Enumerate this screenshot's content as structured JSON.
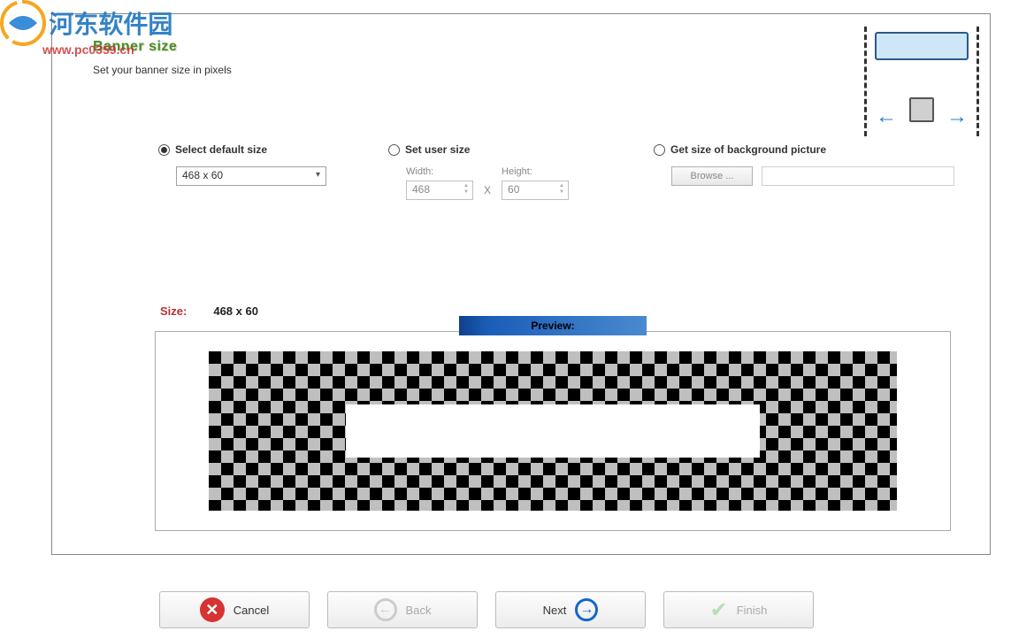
{
  "watermark": {
    "text": "河东软件园",
    "url": "www.pc0359.cn"
  },
  "header": {
    "title": "Banner size",
    "subtitle": "Set your banner size in pixels"
  },
  "options": {
    "selected": "default",
    "default": {
      "label": "Select default size",
      "value": "468 x 60"
    },
    "user": {
      "label": "Set user size",
      "width_label": "Width:",
      "width_value": "468",
      "sep": "X",
      "height_label": "Height:",
      "height_value": "60"
    },
    "background": {
      "label": "Get size of background picture",
      "browse_label": "Browse ...",
      "path": ""
    }
  },
  "size_display": {
    "label": "Size:",
    "value": "468 x 60"
  },
  "preview": {
    "label": "Preview:"
  },
  "nav": {
    "cancel": "Cancel",
    "back": "Back",
    "next": "Next",
    "finish": "Finish"
  }
}
